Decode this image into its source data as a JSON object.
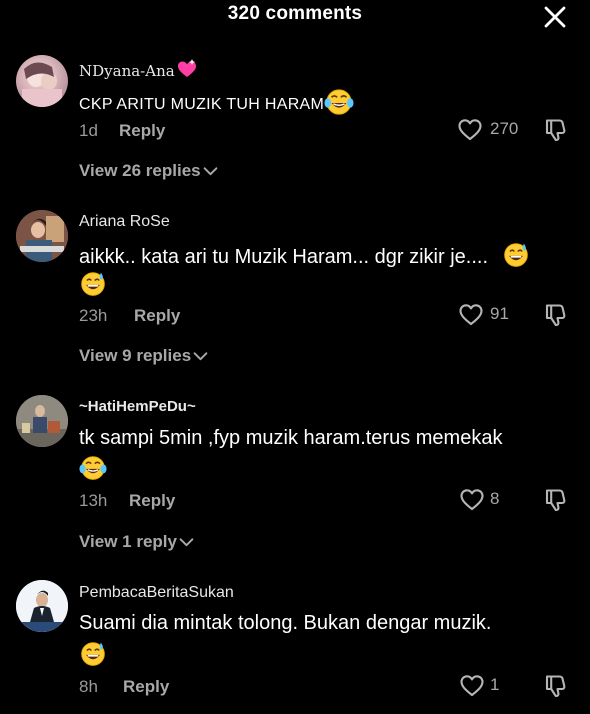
{
  "header": {
    "title": "320 comments"
  },
  "comments": [
    {
      "username": "NDyana-Ana",
      "username_emoji": "sparkling-heart-emoji",
      "text": "CKP ARITU MUZIK TUH HARAM",
      "text_emoji": "tears-of-joy-emoji",
      "time": "1d",
      "reply_label": "Reply",
      "likes": "270",
      "view_replies": "View 26 replies"
    },
    {
      "username": "Ariana RoSe",
      "text": "aikkk.. kata ari tu Muzik Haram... dgr zikir je....",
      "text_emoji": "grinning-sweat-emoji",
      "extra_emoji": "grinning-sweat-emoji",
      "time": "23h",
      "reply_label": "Reply",
      "likes": "91",
      "view_replies": "View 9 replies"
    },
    {
      "username": "~HatiHemPeDu~",
      "text": "tk sampi 5min ,fyp muzik haram.terus memekak",
      "extra_emoji": "tears-of-joy-emoji",
      "time": "13h",
      "reply_label": "Reply",
      "likes": "8",
      "view_replies": "View 1 reply"
    },
    {
      "username": "PembacaBeritaSukan",
      "text": "Suami dia mintak tolong. Bukan dengar muzik.",
      "extra_emoji": "grinning-sweat-emoji",
      "time": "8h",
      "reply_label": "Reply",
      "likes": "1"
    }
  ],
  "colors": {
    "background": "#000000",
    "text_primary": "#ffffff",
    "text_secondary": "#a8a8a8",
    "heart_accent": "#ff3fa4",
    "emoji_yellow": "#ffcc33"
  }
}
